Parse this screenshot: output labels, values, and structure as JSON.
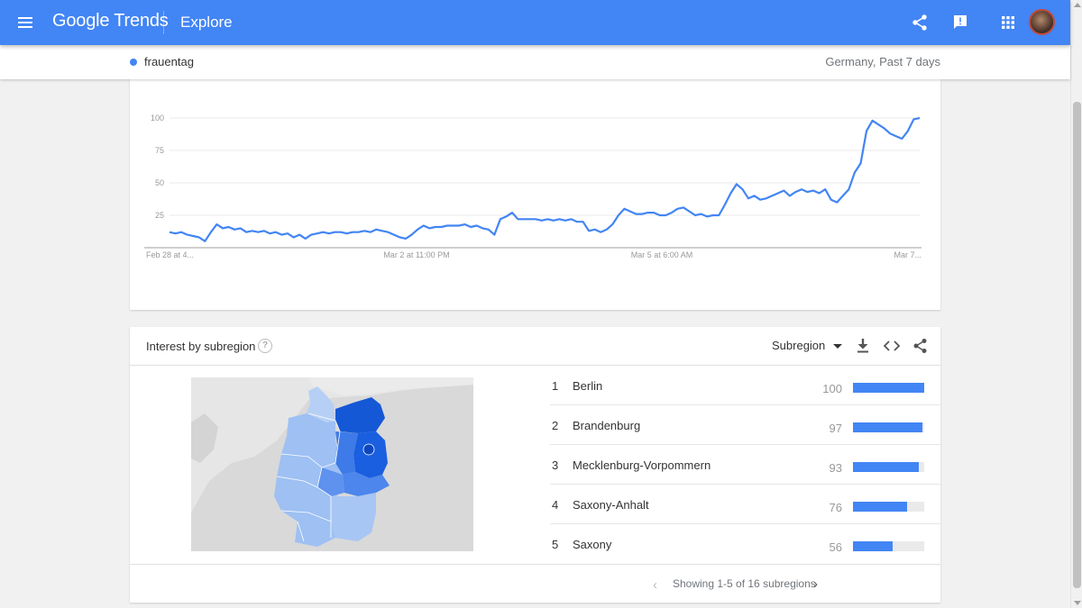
{
  "header": {
    "logo_text": "Google Trends",
    "page_title": "Explore",
    "colors": {
      "bar": "#4285f4"
    },
    "icons": [
      "menu-icon",
      "share-icon",
      "feedback-icon",
      "apps-icon",
      "avatar"
    ]
  },
  "term_bar": {
    "term": "frauentag",
    "term_color": "#4285f4",
    "scope": "Germany, Past 7 days"
  },
  "chart_data": {
    "type": "line",
    "title": "",
    "xlabel": "",
    "ylabel": "",
    "ylim": [
      0,
      100
    ],
    "yticks": [
      "100",
      "75",
      "50",
      "25"
    ],
    "xtick_labels": [
      "Feb 28 at 4...",
      "Mar 2 at 11:00 PM",
      "Mar 5 at 6:00 AM",
      "Mar 7..."
    ],
    "grid": true,
    "series": [
      {
        "color": "#4285f4",
        "values": [
          12,
          11,
          12,
          10,
          9,
          8,
          5,
          12,
          18,
          15,
          16,
          14,
          15,
          12,
          13,
          12,
          13,
          11,
          12,
          10,
          11,
          8,
          10,
          7,
          10,
          11,
          12,
          11,
          12,
          12,
          11,
          12,
          12,
          13,
          12,
          14,
          13,
          12,
          10,
          8,
          7,
          10,
          14,
          17,
          15,
          16,
          16,
          17,
          17,
          17,
          18,
          16,
          17,
          15,
          14,
          10,
          22,
          24,
          27,
          22,
          22,
          22,
          22,
          21,
          22,
          21,
          22,
          21,
          22,
          20,
          20,
          13,
          14,
          12,
          14,
          18,
          25,
          30,
          28,
          26,
          26,
          27,
          27,
          25,
          25,
          27,
          30,
          31,
          28,
          25,
          26,
          24,
          25,
          25,
          33,
          42,
          49,
          45,
          38,
          40,
          37,
          38,
          40,
          42,
          44,
          40,
          43,
          45,
          43,
          44,
          42,
          45,
          37,
          35,
          40,
          45,
          58,
          65,
          90,
          98,
          95,
          92,
          88,
          86,
          84,
          90,
          99,
          100
        ]
      }
    ]
  },
  "subregion": {
    "title": "Interest by subregion",
    "help_icon": "?",
    "selector_label": "Subregion",
    "icons": [
      "download-icon",
      "embed-icon",
      "share-icon"
    ],
    "map_colors": {
      "dark": "#1558d6",
      "mid": "#3e7be8",
      "light": "#9ec0f3",
      "other": "#d8d8d8",
      "water": "#e0e0e0"
    },
    "rows": [
      {
        "rank": "1",
        "name": "Berlin",
        "value": "100",
        "fraction": 1.0
      },
      {
        "rank": "2",
        "name": "Brandenburg",
        "value": "97",
        "fraction": 0.97
      },
      {
        "rank": "3",
        "name": "Mecklenburg-Vorpommern",
        "value": "93",
        "fraction": 0.93
      },
      {
        "rank": "4",
        "name": "Saxony-Anhalt",
        "value": "76",
        "fraction": 0.76
      },
      {
        "rank": "5",
        "name": "Saxony",
        "value": "56",
        "fraction": 0.56
      }
    ],
    "pager": "Showing 1-5 of 16 subregions"
  }
}
